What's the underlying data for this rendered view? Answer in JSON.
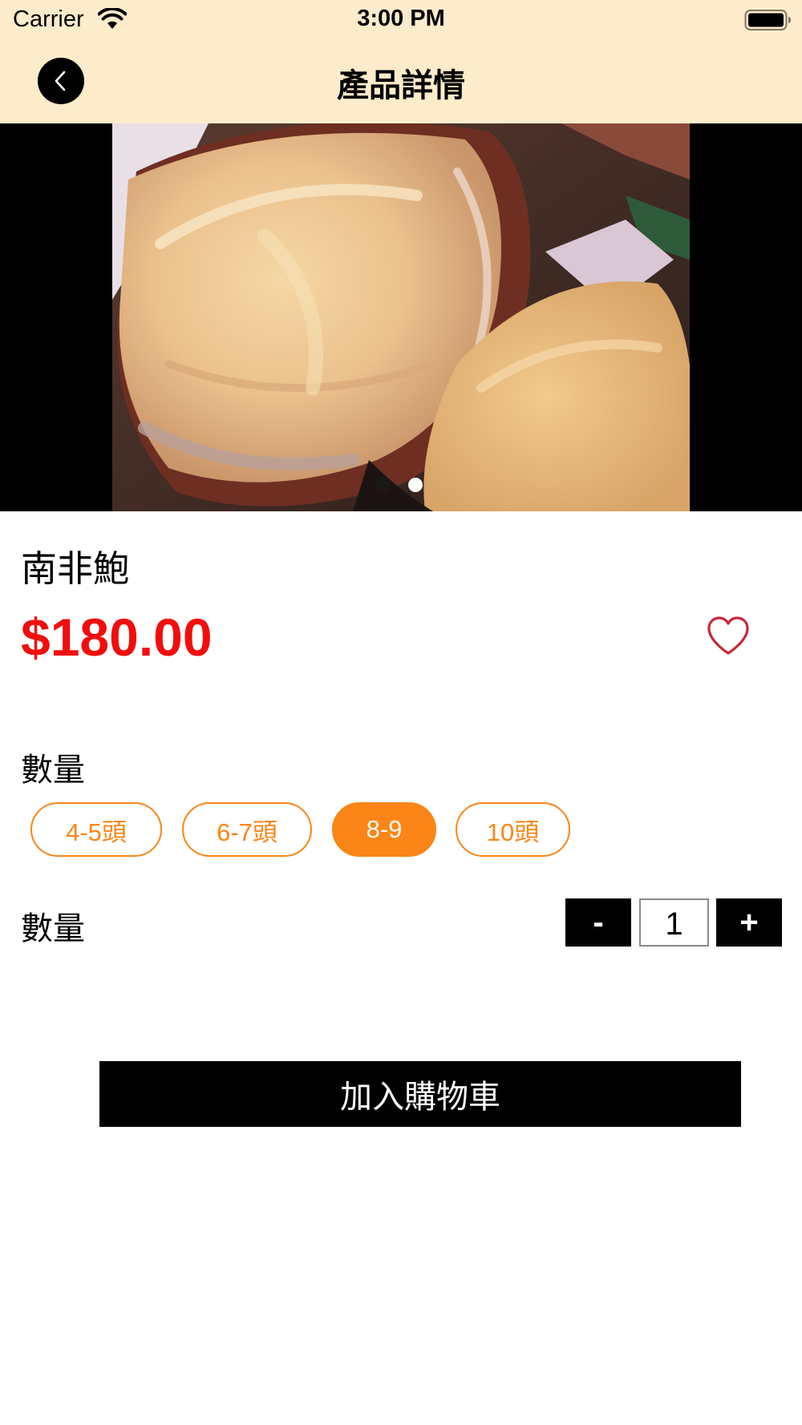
{
  "status_bar": {
    "carrier": "Carrier",
    "time": "3:00 PM"
  },
  "nav": {
    "title": "產品詳情",
    "back_icon": "chevron-left-icon"
  },
  "carousel": {
    "page_count": 2,
    "active_page": 2
  },
  "product": {
    "name": "南非鮑",
    "price": "$180.00",
    "favorite_icon": "heart-outline-icon"
  },
  "options": {
    "label": "數量",
    "items": [
      {
        "label": "4-5頭",
        "selected": false
      },
      {
        "label": "6-7頭",
        "selected": false
      },
      {
        "label": "8-9",
        "selected": true
      },
      {
        "label": "10頭",
        "selected": false
      }
    ]
  },
  "quantity": {
    "label": "數量",
    "minus_label": "-",
    "value": "1",
    "plus_label": "+"
  },
  "cart": {
    "add_label": "加入購物車"
  },
  "colors": {
    "header_bg": "#fdeccb",
    "accent_orange": "#fb8516",
    "price_red": "#f20d0d",
    "heart_red": "#c8283a"
  }
}
